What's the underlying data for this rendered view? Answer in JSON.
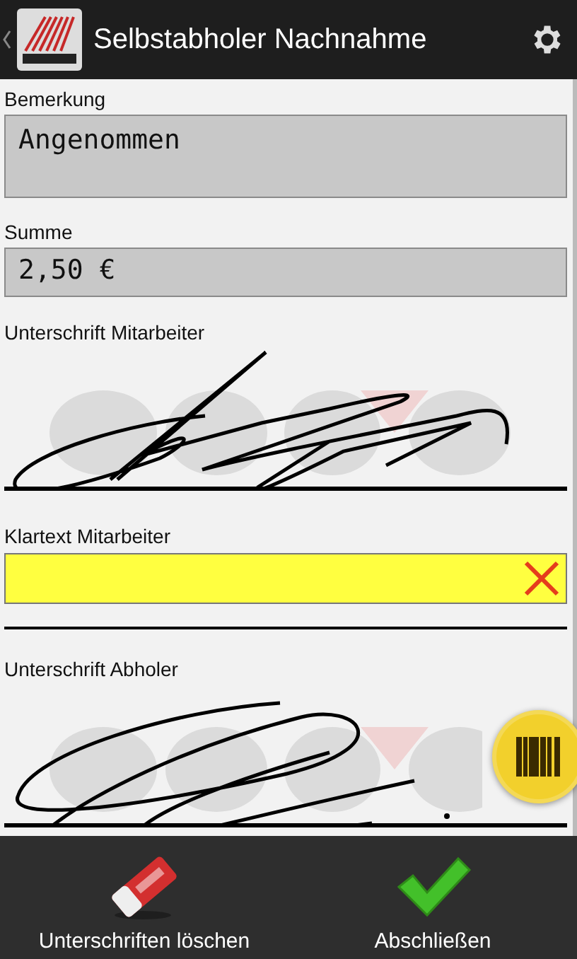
{
  "app_bar": {
    "title": "Selbstabholer Nachnahme"
  },
  "fields": [
    {
      "kind": "text",
      "label": "Bemerkung",
      "value": "Angenommen"
    },
    {
      "kind": "amount",
      "label": "Summe",
      "value": "2,50 €"
    },
    {
      "kind": "signature",
      "label": "Unterschrift Mitarbeiter"
    },
    {
      "kind": "clear",
      "label": "Klartext Mitarbeiter"
    },
    {
      "kind": "signature",
      "label": "Unterschrift Abholer"
    }
  ],
  "actions": [
    {
      "kind": "eraser",
      "label": "Unterschriften löschen"
    },
    {
      "kind": "check",
      "label": "Abschließen"
    }
  ]
}
